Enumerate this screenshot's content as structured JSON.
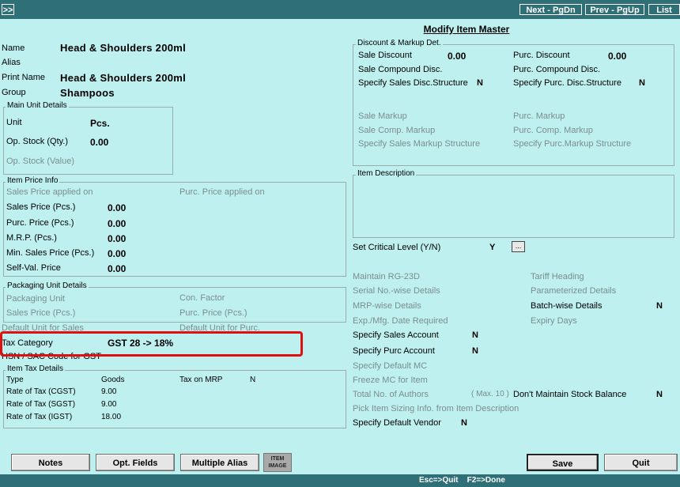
{
  "topbar": {
    "corner": ">>",
    "next": "Next - PgDn",
    "prev": "Prev - PgUp",
    "list": "List"
  },
  "title": "Modify Item Master",
  "item": {
    "name_label": "Name",
    "name_value": "Head & Shoulders 200ml",
    "alias_label": "Alias",
    "print_label": "Print Name",
    "print_value": "Head & Shoulders 200ml",
    "group_label": "Group",
    "group_value": "Shampoos"
  },
  "main_unit": {
    "legend": "Main Unit Details",
    "unit_label": "Unit",
    "unit_value": "Pcs.",
    "opstock_label": "Op. Stock (Qty.)",
    "opstock_value": "0.00",
    "opvalue_label": "Op. Stock (Value)"
  },
  "price": {
    "legend": "Item Price Info",
    "sales_applied": "Sales Price applied on",
    "purc_applied": "Purc. Price applied on",
    "sales_label": "Sales Price (Pcs.)",
    "sales_value": "0.00",
    "purc_label": "Purc. Price (Pcs.)",
    "purc_value": "0.00",
    "mrp_label": "M.R.P. (Pcs.)",
    "mrp_value": "0.00",
    "min_label": "Min. Sales Price (Pcs.)",
    "min_value": "0.00",
    "self_label": "Self-Val. Price",
    "self_value": "0.00"
  },
  "packaging": {
    "legend": "Packaging Unit Details",
    "unit_label": "Packaging Unit",
    "factor_label": "Con. Factor",
    "sales_label": "Sales Price (Pcs.)",
    "purc_label": "Purc. Price (Pcs.)",
    "default_sales": "Default Unit for Sales",
    "default_purc": "Default Unit for Purc."
  },
  "tax": {
    "category_label": "Tax Category",
    "category_value": "GST 28 -> 18%",
    "hsn_label": "HSN / SAC Code for GST"
  },
  "item_tax": {
    "legend": "Item Tax Details",
    "type_label": "Type",
    "type_value": "Goods",
    "mrp_label": "Tax on MRP",
    "mrp_value": "N",
    "cgst_label": "Rate of Tax (CGST)",
    "cgst_value": "9.00",
    "sgst_label": "Rate of Tax (SGST)",
    "sgst_value": "9.00",
    "igst_label": "Rate of Tax (IGST)",
    "igst_value": "18.00"
  },
  "discount": {
    "legend": "Discount & Markup Det.",
    "sale_disc_label": "Sale Discount",
    "sale_disc_value": "0.00",
    "purc_disc_label": "Purc. Discount",
    "purc_disc_value": "0.00",
    "sale_comp_label": "Sale Compound Disc.",
    "purc_comp_label": "Purc. Compound Disc.",
    "sale_struct_label": "Specify Sales Disc.Structure",
    "sale_struct_value": "N",
    "purc_struct_label": "Specify  Purc. Disc.Structure",
    "purc_struct_value": "N",
    "sale_markup": "Sale Markup",
    "purc_markup": "Purc. Markup",
    "sale_comp_markup": "Sale Comp. Markup",
    "purc_comp_markup": "Purc. Comp. Markup",
    "sale_markup_struct": "Specify Sales Markup Structure",
    "purc_markup_struct": "Specify  Purc.Markup Structure"
  },
  "description": {
    "legend": "Item Description"
  },
  "right": {
    "critical_label": "Set Critical Level (Y/N)",
    "critical_value": "Y",
    "ellipsis": "...",
    "rg23d": "Maintain RG-23D",
    "tariff": "Tariff Heading",
    "serial": "Serial No.-wise Details",
    "param": "Parameterized Details",
    "mrpwise": "MRP-wise Details",
    "batch_label": "Batch-wise Details",
    "batch_value": "N",
    "expmfg": "Exp./Mfg. Date Required",
    "expiry": "Expiry Days",
    "sales_acc_label": "Specify Sales Account",
    "sales_acc_value": "N",
    "purc_acc_label": "Specify Purc Account",
    "purc_acc_value": "N",
    "default_mc": "Specify Default MC",
    "freeze_mc": "Freeze MC for Item",
    "authors": "Total No. of Authors",
    "max10": "( Max. 10 )",
    "dont_maintain_label": "Don't Maintain Stock Balance",
    "dont_maintain_value": "N",
    "pick_sizing": "Pick Item Sizing Info. from Item Description",
    "vendor_label": "Specify Default Vendor",
    "vendor_value": "N"
  },
  "buttons": {
    "notes": "Notes",
    "opt": "Opt. Fields",
    "alias": "Multiple Alias",
    "image_line1": "ITEM",
    "image_line2": "IMAGE",
    "save": "Save",
    "quit": "Quit"
  },
  "status": "Esc=>Quit    F2=>Done"
}
